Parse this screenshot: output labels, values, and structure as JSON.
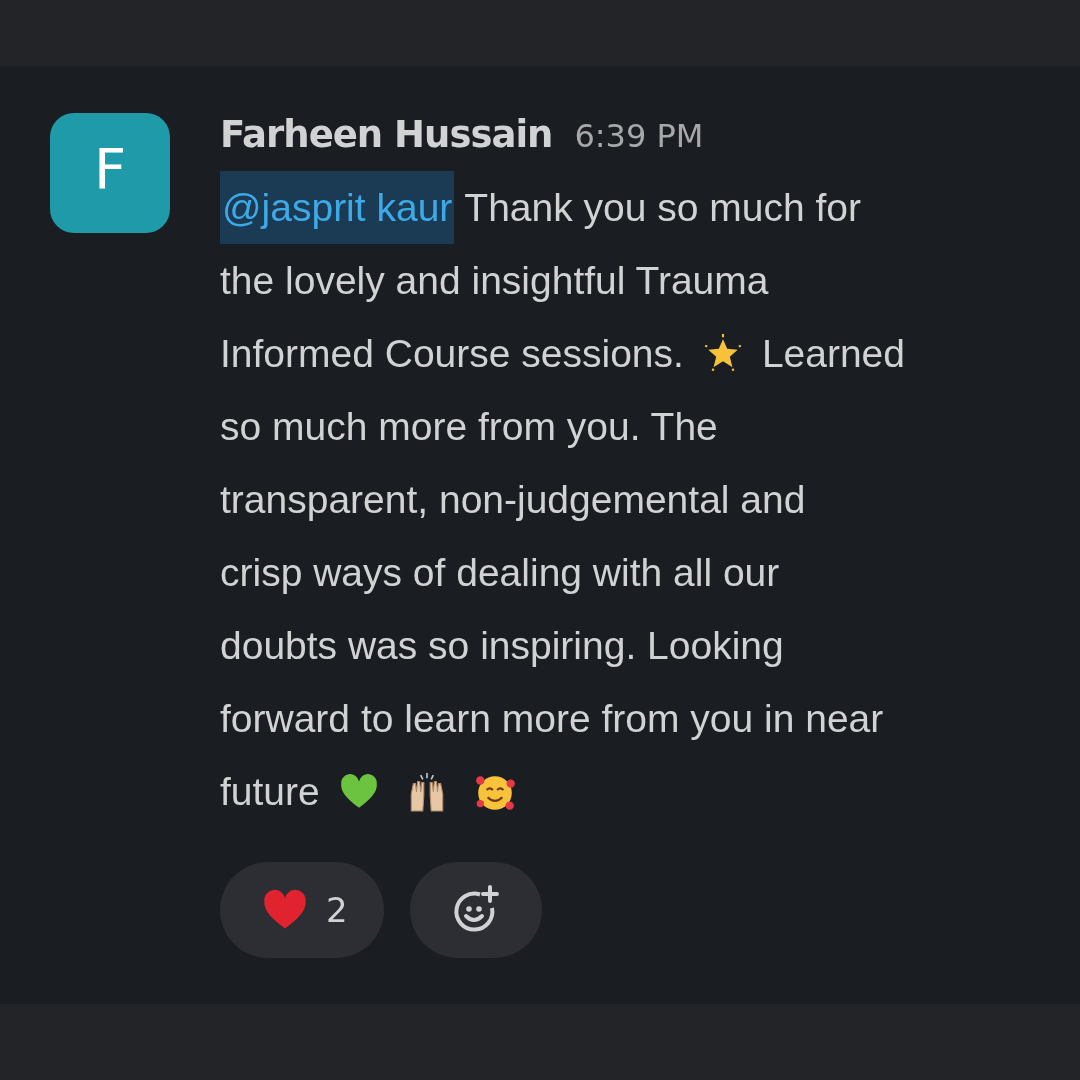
{
  "message": {
    "avatar_letter": "F",
    "author": "Farheen Hussain",
    "time": "6:39 PM",
    "lines": [
      [
        {
          "kind": "mention",
          "text": "@jasprit kaur"
        },
        {
          "kind": "text",
          "text": "Thank you so much for"
        }
      ],
      [
        {
          "kind": "text",
          "text": "the lovely and insightful Trauma"
        }
      ],
      [
        {
          "kind": "text",
          "text": "Informed Course sessions."
        },
        {
          "kind": "star"
        },
        {
          "kind": "text",
          "text": "Learned"
        }
      ],
      [
        {
          "kind": "text",
          "text": "so much more from you. The"
        }
      ],
      [
        {
          "kind": "text",
          "text": "transparent, non-judgemental and"
        }
      ],
      [
        {
          "kind": "text",
          "text": "crisp ways of dealing with all our"
        }
      ],
      [
        {
          "kind": "text",
          "text": "doubts was so inspiring. Looking"
        }
      ],
      [
        {
          "kind": "text",
          "text": "forward to learn more from you in near"
        }
      ],
      [
        {
          "kind": "text",
          "text": "future"
        },
        {
          "kind": "heart"
        },
        {
          "kind": "hands"
        },
        {
          "kind": "smiley"
        }
      ]
    ],
    "reactions": [
      {
        "kind": "heart",
        "count": "2"
      },
      {
        "kind": "add"
      }
    ]
  }
}
